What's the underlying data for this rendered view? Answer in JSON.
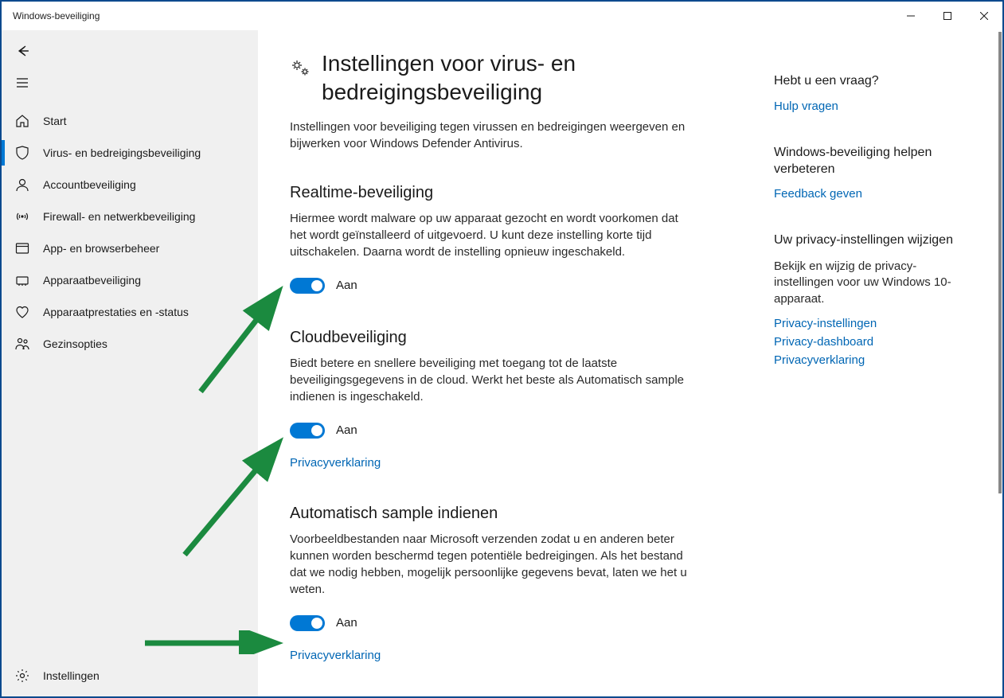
{
  "window": {
    "title": "Windows-beveiliging"
  },
  "sidebar": {
    "items": [
      {
        "label": "Start"
      },
      {
        "label": "Virus- en bedreigingsbeveiliging"
      },
      {
        "label": "Accountbeveiliging"
      },
      {
        "label": "Firewall- en netwerkbeveiliging"
      },
      {
        "label": "App- en browserbeheer"
      },
      {
        "label": "Apparaatbeveiliging"
      },
      {
        "label": "Apparaatprestaties en -status"
      },
      {
        "label": "Gezinsopties"
      }
    ],
    "settings": "Instellingen"
  },
  "page": {
    "title": "Instellingen voor virus- en bedreigingsbeveiliging",
    "description": "Instellingen voor beveiliging tegen virussen en bedreigingen weergeven en bijwerken voor Windows Defender Antivirus."
  },
  "sections": {
    "realtime": {
      "title": "Realtime-beveiliging",
      "description": "Hiermee wordt malware op uw apparaat gezocht en wordt voorkomen dat het wordt geïnstalleerd of uitgevoerd. U kunt deze instelling korte tijd uitschakelen. Daarna wordt de instelling opnieuw ingeschakeld.",
      "toggle_state": "Aan"
    },
    "cloud": {
      "title": "Cloudbeveiliging",
      "description": "Biedt betere en snellere beveiliging met toegang tot de laatste beveiligingsgegevens in de cloud. Werkt het beste als Automatisch sample indienen is ingeschakeld.",
      "toggle_state": "Aan",
      "link": "Privacyverklaring"
    },
    "sample": {
      "title": "Automatisch sample indienen",
      "description": "Voorbeeldbestanden naar Microsoft verzenden zodat u en anderen beter kunnen worden beschermd tegen potentiële bedreigingen. Als het bestand dat we nodig hebben, mogelijk persoonlijke gegevens bevat, laten we het u weten.",
      "toggle_state": "Aan",
      "link": "Privacyverklaring"
    }
  },
  "rail": {
    "help": {
      "title": "Hebt u een vraag?",
      "link": "Hulp vragen"
    },
    "improve": {
      "title": "Windows-beveiliging helpen verbeteren",
      "link": "Feedback geven"
    },
    "privacy": {
      "title": "Uw privacy-instellingen wijzigen",
      "description": "Bekijk en wijzig de privacy-instellingen voor uw Windows 10-apparaat.",
      "links": [
        "Privacy-instellingen",
        "Privacy-dashboard",
        "Privacyverklaring"
      ]
    }
  },
  "colors": {
    "accent": "#0078d4",
    "link": "#0066b4",
    "arrow": "#1b8a3f"
  }
}
